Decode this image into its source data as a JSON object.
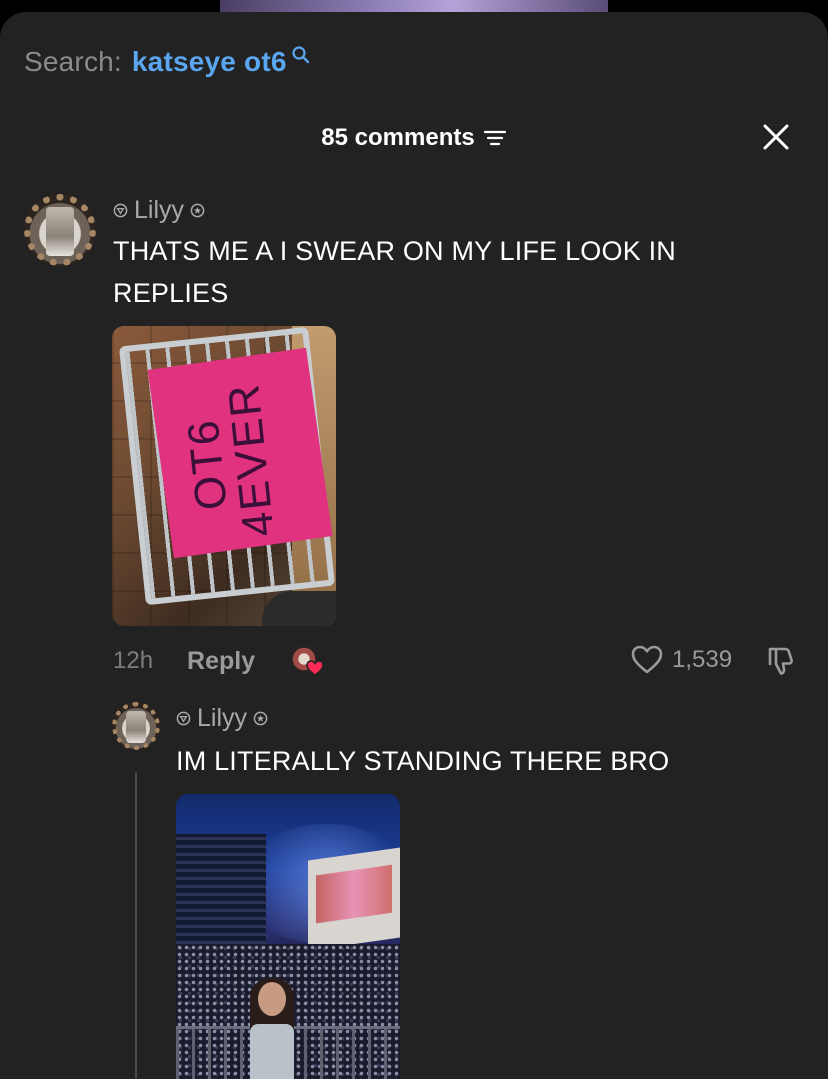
{
  "search": {
    "label": "Search:",
    "term": "katseye ot6"
  },
  "header": {
    "comment_count": "85 comments"
  },
  "comments": [
    {
      "username": "Lilyy",
      "text_line1": "THATS ME A I SWEAR ON MY LIFE LOOK IN",
      "text_line2": "REPLIES",
      "photo_text_line1": "OT6",
      "photo_text_line2": "4EVER",
      "time": "12h",
      "reply_label": "Reply",
      "likes": "1,539"
    }
  ],
  "replies": [
    {
      "username": "Lilyy",
      "text": "IM LITERALLY STANDING THERE BRO"
    }
  ],
  "colors": {
    "sheet_bg": "#222222",
    "search_accent": "#5aa6f0",
    "heart_red": "#fe2c55"
  },
  "icons": [
    "search-icon",
    "filter-icon",
    "close-icon",
    "user-badge-icon",
    "verified-icon",
    "heart-icon",
    "dislike-icon",
    "creator-heart-icon"
  ]
}
